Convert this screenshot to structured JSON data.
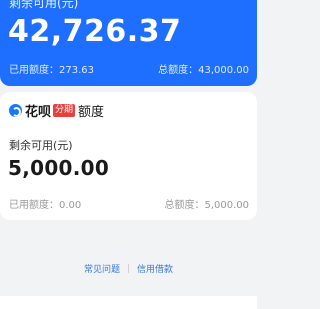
{
  "top_card": {
    "label": "剩余可用(元)",
    "amount": "42,726.37",
    "used": "已用额度：273.63",
    "total": "总额度：43,000.00"
  },
  "huabei_card": {
    "brand": "花呗",
    "badge": "分期",
    "quota": "额度",
    "label": "剩余可用(元)",
    "amount": "5,000.00",
    "used": "已用额度：0.00",
    "total": "总额度：5,000.00"
  },
  "footer": {
    "faq": "常见问题",
    "separator": "|",
    "credit_purchase": "信用借款"
  },
  "colors": {
    "brand_blue": "#1e6fff",
    "badge_red": "#e8413c",
    "link_blue": "#3a78d8"
  }
}
